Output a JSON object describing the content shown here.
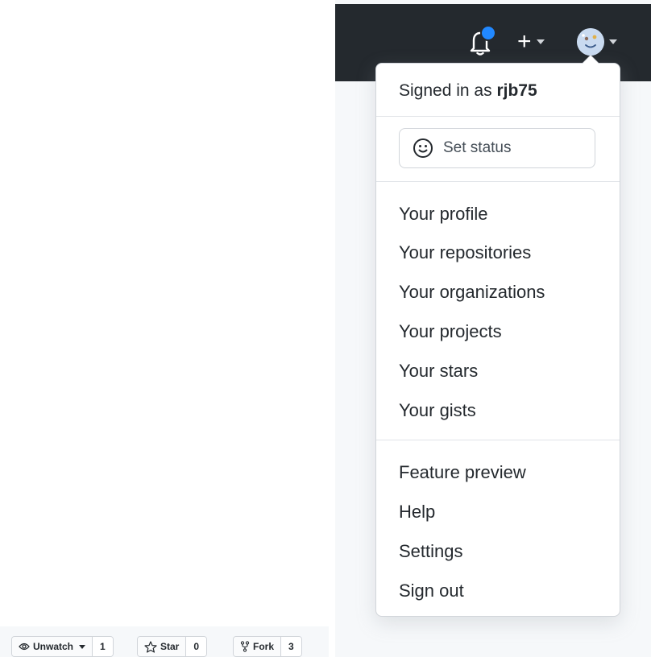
{
  "header": {
    "notifications_icon": "bell-icon",
    "create_icon": "plus-icon",
    "avatar_icon": "avatar-icon"
  },
  "dropdown": {
    "signed_in_prefix": "Signed in as",
    "username": "rjb75",
    "set_status_label": "Set status",
    "items_group1": [
      "Your profile",
      "Your repositories",
      "Your organizations",
      "Your projects",
      "Your stars",
      "Your gists"
    ],
    "items_group2": [
      "Feature preview",
      "Help",
      "Settings",
      "Sign out"
    ]
  },
  "repo_actions": {
    "unwatch_label": "Unwatch",
    "unwatch_count": "1",
    "star_label": "Star",
    "star_count": "0",
    "fork_label": "Fork",
    "fork_count": "3"
  },
  "colors": {
    "header_bg": "#24292e",
    "notification_dot": "#2188ff",
    "border": "#d1d5da"
  }
}
